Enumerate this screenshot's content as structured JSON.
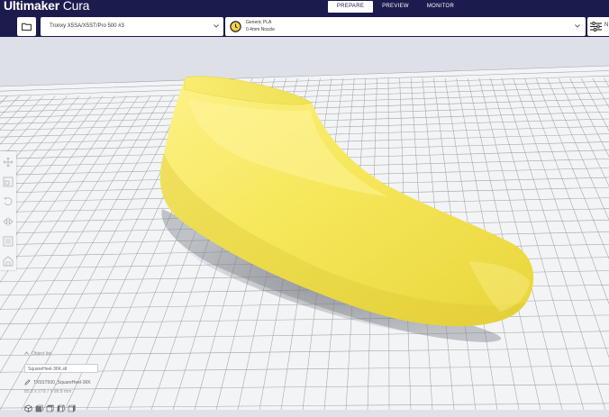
{
  "app": {
    "title_bold": "Ultimaker",
    "title_light": " Cura"
  },
  "stages": [
    {
      "label": "PREPARE",
      "active": true
    },
    {
      "label": "PREVIEW",
      "active": false
    },
    {
      "label": "MONITOR",
      "active": false
    }
  ],
  "printer": {
    "selected": "Tronxy X5SA/X5ST/Pro 500 #3"
  },
  "material": {
    "material_name": "Generic PLA",
    "nozzle": "0.4mm Nozzle"
  },
  "settings": {
    "label": "N"
  },
  "objects": {
    "header": "Object list",
    "item": "SquareHeel-36K.stl",
    "job_name": "TX5ST500_SquareHeel-36K",
    "dimensions": "85.8 x 279.7 x 98.8 mm"
  },
  "colors": {
    "header_bg": "#1c1b4e",
    "model": "#f6e75a",
    "build_plate": "#f3f4f6",
    "grid_line": "#9ea3ab"
  },
  "icons": {
    "open": "folder-icon",
    "print_settings": "clock-icon",
    "settings": "sliders-icon",
    "tools": [
      "move-icon",
      "scale-icon",
      "rotate-icon",
      "mirror-icon",
      "per-model-settings-icon",
      "support-blocker-icon"
    ],
    "views": [
      "3d-view-icon",
      "front-view-icon",
      "top-view-icon",
      "left-view-icon",
      "right-view-icon"
    ]
  }
}
